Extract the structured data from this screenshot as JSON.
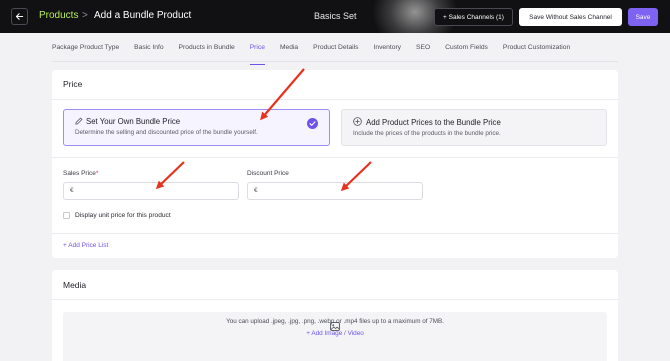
{
  "header": {
    "back_icon": "arrow-left-icon",
    "breadcrumb_root": "Products",
    "breadcrumb_separator": ">",
    "page_title": "Add a Bundle Product",
    "center_label": "Basics Set",
    "sales_channels_label": "+ Sales Channels (1)",
    "save_without_label": "Save Without Sales Channel",
    "save_label": "Save"
  },
  "tabs": [
    {
      "label": "Package Product Type"
    },
    {
      "label": "Basic Info"
    },
    {
      "label": "Products in Bundle"
    },
    {
      "label": "Price",
      "active": true
    },
    {
      "label": "Media"
    },
    {
      "label": "Product Details"
    },
    {
      "label": "Inventory"
    },
    {
      "label": "SEO"
    },
    {
      "label": "Custom Fields"
    },
    {
      "label": "Product Customization"
    }
  ],
  "price": {
    "title": "Price",
    "option_own": {
      "icon": "pencil-icon",
      "title": "Set Your Own Bundle Price",
      "description": "Determine the selling and discounted price of the bundle yourself.",
      "selected": true
    },
    "option_add": {
      "icon": "plus-circle-icon",
      "title": "Add Product Prices to the Bundle Price",
      "description": "Include the prices of the products in the bundle price.",
      "selected": false
    },
    "sales_price_label": "Sales Price",
    "required_mark": "*",
    "sales_price_prefix": "€",
    "sales_price_value": "",
    "discount_price_label": "Discount Price",
    "discount_price_prefix": "€",
    "discount_price_value": "",
    "unit_price_checkbox_label": "Display unit price for this product",
    "unit_price_checked": false,
    "add_price_list_label": "+ Add Price List"
  },
  "media": {
    "title": "Media",
    "upload_icon": "image-icon",
    "upload_hint": "You can upload .jpeg, .jpg, .png, .webp or .mp4 files up to a maximum of 7MB.",
    "upload_link": "+ Add Image / Video"
  },
  "colors": {
    "accent": "#7e62f2",
    "breadcrumb": "#b5ed5a",
    "annotation_arrows": "#e8321f",
    "topbar": "#111113"
  }
}
